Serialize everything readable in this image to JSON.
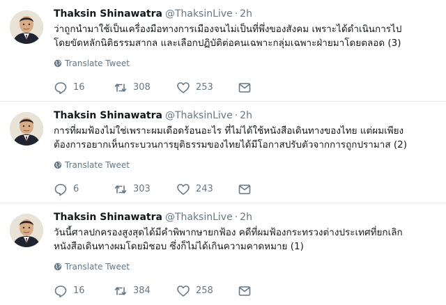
{
  "tweets": [
    {
      "name": "Thaksin Shinawatra",
      "handle": "@ThaksinLive",
      "separator": "·",
      "time": "2h",
      "lines": [
        "ว่าถูกนำมาใช้เป็นเครื่องมือทางการเมืองจนไม่เป็นที่พึ่งของสังคม เพราะได้ดำเนินการไป",
        "โดยขัดหลักนิติธรรมสากล และเลือกปฏิบัติต่อคนเฉพาะกลุ่มเฉพาะฝ่ายมาโดยตลอด (3)"
      ],
      "translate_label": "Translate Tweet",
      "replies": "16",
      "retweets": "308",
      "likes": "253"
    },
    {
      "name": "Thaksin Shinawatra",
      "handle": "@ThaksinLive",
      "separator": "·",
      "time": "2h",
      "lines": [
        "การที่ผมฟ้องไม่ใช่เพราะผมเดือดร้อนอะไร ที่ไม่ได้ใช้หนังสือเดินทางของไทย แต่ผมเพียง",
        "ต้องการอยากเห็นกระบวนการยุติธรรมของไทยได้มีโอกาสปรับตัวจากการถูกปรามาส (2)"
      ],
      "translate_label": "Translate Tweet",
      "replies": "6",
      "retweets": "303",
      "likes": "243"
    },
    {
      "name": "Thaksin Shinawatra",
      "handle": "@ThaksinLive",
      "separator": "·",
      "time": "2h",
      "lines": [
        "วันนี้ศาลปกครองสูงสุดได้มีคำพิพากษายกฟ้อง คดีที่ผมฟ้องกระทรวงต่างประเทศที่ยกเลิก",
        "หนังสือเดินทางผมโดยมิชอบ ซึ่งก็ไม่ได้เกินความคาดหมาย (1)"
      ],
      "translate_label": "Translate Tweet",
      "replies": "16",
      "retweets": "384",
      "likes": "258"
    }
  ],
  "colors": {
    "text": "#14171a",
    "muted": "#657786",
    "separator": "#e6ecf0"
  },
  "icons": {
    "avatar": "profile-photo",
    "translate": "globe-icon",
    "reply": "reply-icon",
    "retweet": "retweet-icon",
    "like": "heart-icon",
    "dm": "envelope-icon"
  }
}
